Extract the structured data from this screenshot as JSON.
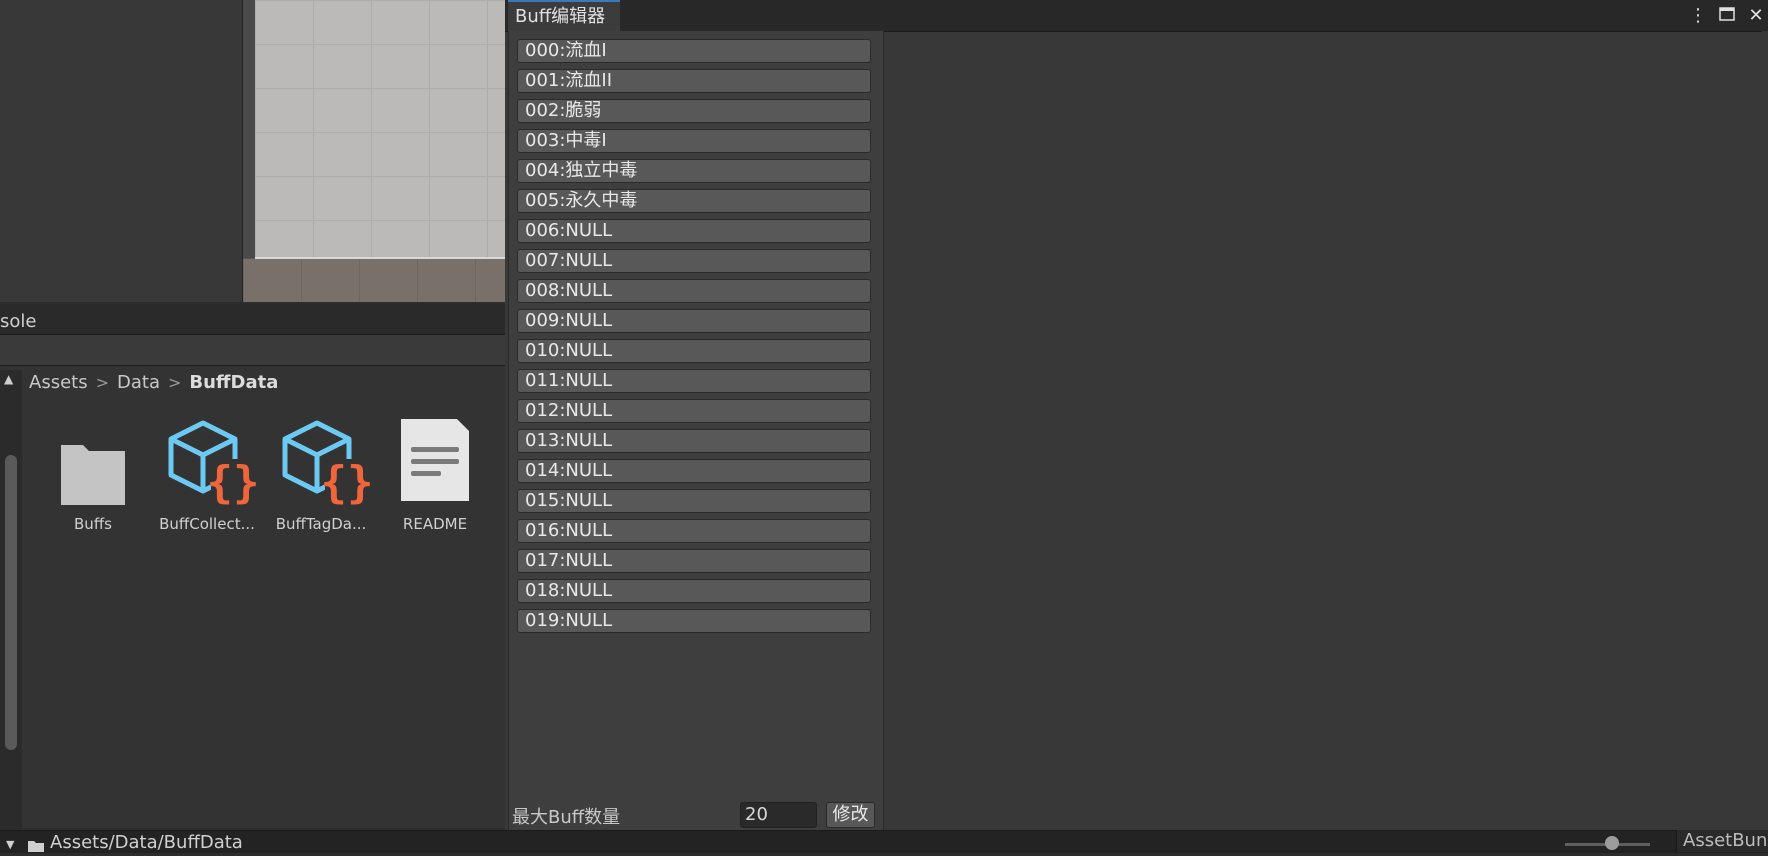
{
  "console": {
    "tab_label": "sole"
  },
  "project": {
    "breadcrumb": [
      "Assets",
      "Data",
      "BuffData"
    ],
    "assets": [
      {
        "name": "Buffs",
        "icon": "folder-icon"
      },
      {
        "name": "BuffCollect...",
        "icon": "scriptable-object-icon"
      },
      {
        "name": "BuffTagDa...",
        "icon": "scriptable-object-icon"
      },
      {
        "name": "README",
        "icon": "text-document-icon"
      }
    ],
    "path": "Assets/Data/BuffData",
    "asset_bundle_label": "AssetBund"
  },
  "editor": {
    "tab_title": "Buff编辑器",
    "buffs": [
      "000:流血I",
      "001:流血II",
      "002:脆弱",
      "003:中毒I",
      "004:独立中毒",
      "005:永久中毒",
      "006:NULL",
      "007:NULL",
      "008:NULL",
      "009:NULL",
      "010:NULL",
      "011:NULL",
      "012:NULL",
      "013:NULL",
      "014:NULL",
      "015:NULL",
      "016:NULL",
      "017:NULL",
      "018:NULL",
      "019:NULL"
    ],
    "max_label": "最大Buff数量",
    "max_value": "20",
    "modify_button": "修改"
  },
  "colors": {
    "accent": "#3a79bb",
    "icon_blue": "#6ccaf2",
    "icon_orange": "#f0663c",
    "folder_gray": "#c4c4c4"
  }
}
